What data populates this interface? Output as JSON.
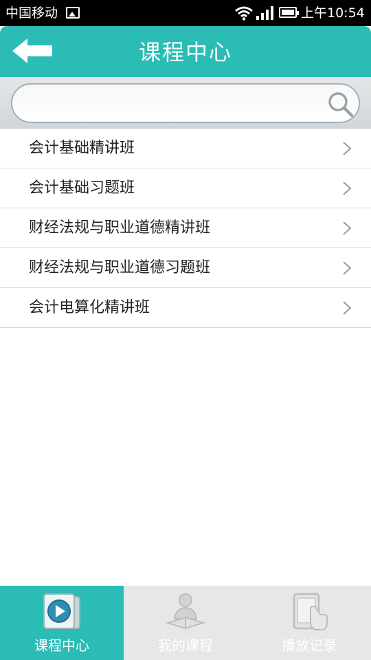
{
  "status_bar": {
    "carrier": "中国移动",
    "time": "上午10:54"
  },
  "header": {
    "title": "课程中心"
  },
  "search": {
    "value": "",
    "placeholder": ""
  },
  "courses": [
    {
      "label": "会计基础精讲班"
    },
    {
      "label": "会计基础习题班"
    },
    {
      "label": "财经法规与职业道德精讲班"
    },
    {
      "label": "财经法规与职业道德习题班"
    },
    {
      "label": "会计电算化精讲班"
    }
  ],
  "tabs": [
    {
      "label": "课程中心",
      "icon": "play-video-icon",
      "active": true
    },
    {
      "label": "我的课程",
      "icon": "reading-person-icon",
      "active": false
    },
    {
      "label": "播放记录",
      "icon": "tablet-touch-icon",
      "active": false
    }
  ],
  "colors": {
    "accent": "#2bbcb6",
    "tabbar_bg": "#e7e7e7"
  }
}
